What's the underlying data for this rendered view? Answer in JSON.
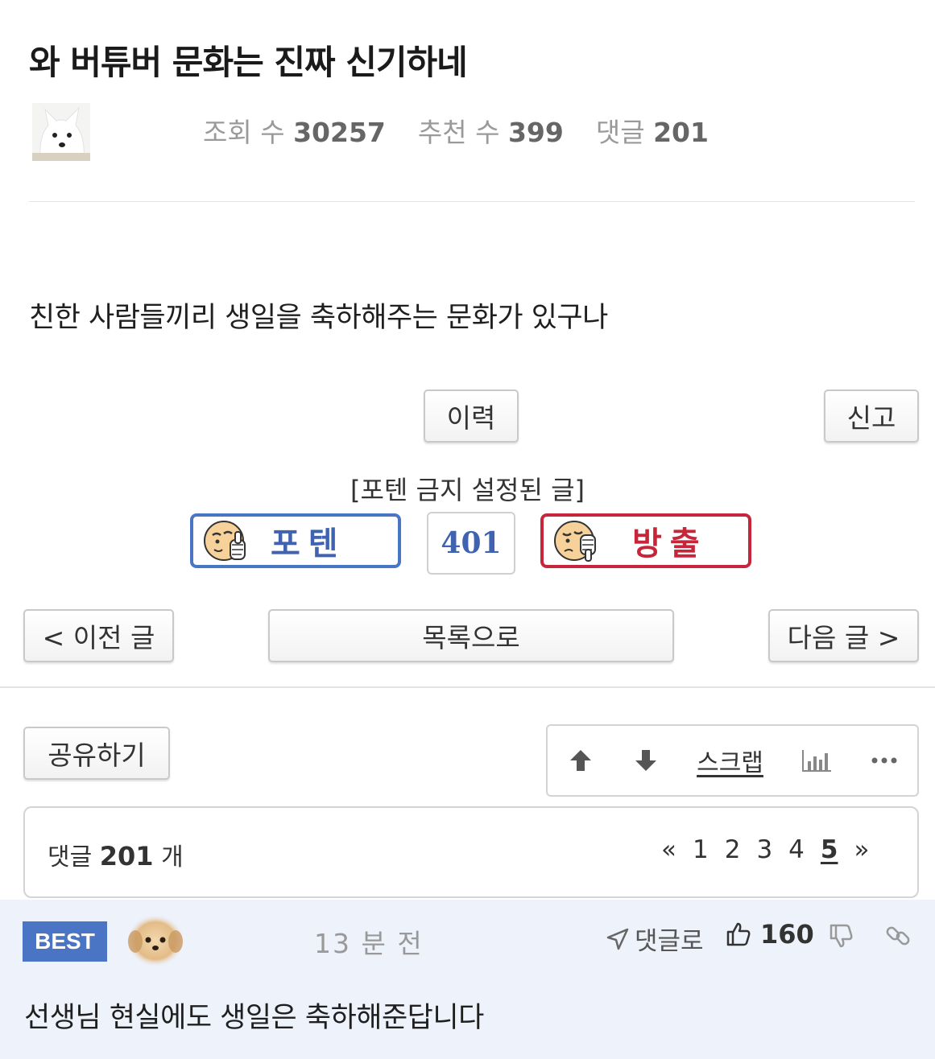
{
  "post": {
    "title": "와 버튜버 문화는 진짜 신기하네",
    "stats": {
      "views_label": "조회 수",
      "views": "30257",
      "recommend_label": "추천 수",
      "recommend": "399",
      "comments_label": "댓글",
      "comments": "201"
    },
    "body": "친한 사람들끼리 생일을 축하해주는 문화가 있구나"
  },
  "actions": {
    "history": "이력",
    "report": "신고",
    "banned_note": "[포텐 금지 설정된 글]",
    "upvote_label": "포텐",
    "vote_count": "401",
    "downvote_label": "방출"
  },
  "navigation": {
    "prev": "< 이전 글",
    "list": "목록으로",
    "next": "다음 글 >"
  },
  "toolbar": {
    "share": "공유하기",
    "scrap": "스크랩"
  },
  "comments_header": {
    "label": "댓글",
    "count": "201",
    "unit": "개",
    "pager": {
      "first": "«",
      "pages": [
        "1",
        "2",
        "3",
        "4",
        "5"
      ],
      "current": "5",
      "last": "»"
    }
  },
  "best_comment": {
    "badge": "BEST",
    "time": "13 분 전",
    "reply": "댓글로",
    "likes": "160",
    "text": "선생님 현실에도 생일은 축하해준답니다"
  },
  "colors": {
    "accent_blue": "#4a74c4",
    "accent_red": "#c7253a",
    "comment_bg": "#eef2fb"
  }
}
